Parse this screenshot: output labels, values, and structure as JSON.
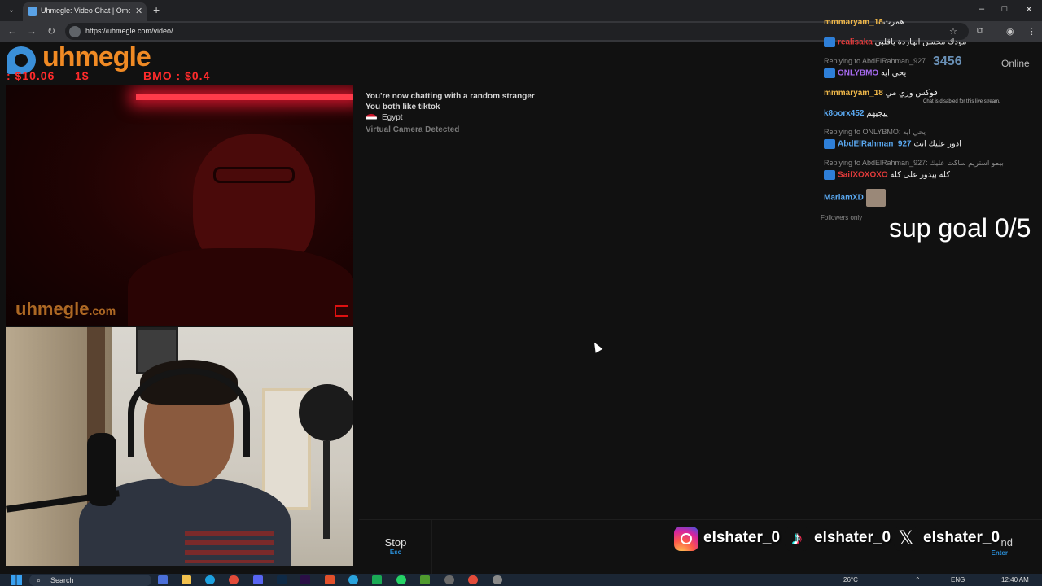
{
  "browser": {
    "tab_title": "Uhmegle: Video Chat | Ome",
    "url": "https://uhmegle.com/video/"
  },
  "logo": {
    "text": "uhmegle"
  },
  "money_overlay": {
    "a": ": $10.06",
    "b": "1$",
    "c": "BMO : $0.4"
  },
  "stranger": {
    "watermark_main": "uhmegle",
    "watermark_suffix": ".com"
  },
  "chat": {
    "line1": "You're now chatting with a random stranger",
    "line2": "You both like tiktok",
    "country": "Egypt",
    "virtual_camera": "Virtual Camera Detected"
  },
  "controls": {
    "stop_label": "Stop",
    "stop_key": "Esc",
    "send_fragment": "nd",
    "send_key": "Enter"
  },
  "socials": [
    {
      "icon": "instagram-icon",
      "handle": "elshater_0"
    },
    {
      "icon": "tiktok-icon",
      "handle": "elshater_0"
    },
    {
      "icon": "x-icon",
      "handle": "elshater_0"
    }
  ],
  "stream_overlay": {
    "viewer_count": "3456",
    "online_word": "Online",
    "chat_disabled": "Chat is disabled for this live stream.",
    "followers_only": "Followers only",
    "sup_goal": "sup goal 0/5",
    "messages": [
      {
        "user": "mmmaryam_18",
        "text": "همرت",
        "color": "#f0b84a"
      },
      {
        "user": "realisaka",
        "text": "مودك محسن انهاردة ياقلبي",
        "color": "#e03a3a",
        "badge": true
      },
      {
        "reply": "Replying to AbdElRahman_927"
      },
      {
        "user": "ONLYBMO",
        "text": "يحي ايه",
        "color": "#a66af0",
        "badge": true
      },
      {
        "user": "mmmaryam_18",
        "text": "فوكس وزي مي",
        "color": "#f0b84a"
      },
      {
        "user": "k8oorx452",
        "text": "ييجيهم",
        "color": "#5aa8f0"
      },
      {
        "reply": "Replying to ONLYBMO: يحي ايه"
      },
      {
        "user": "AbdElRahman_927",
        "text": "ادور عليك انت",
        "color": "#5aa8f0",
        "badge": true
      },
      {
        "reply": "Replying to AbdElRahman_927: بيمو استريم ساكت عليك"
      },
      {
        "user": "SaifXOXOXO",
        "text": "كله بيدور على كله",
        "color": "#e03a3a",
        "badge": true
      },
      {
        "user": "MariamXD",
        "text": "",
        "color": "#5aa8f0",
        "avatar": true
      }
    ]
  },
  "taskbar": {
    "search_label": "Search",
    "weather": "26°C",
    "lang": "ENG",
    "time": "12:40 AM"
  }
}
